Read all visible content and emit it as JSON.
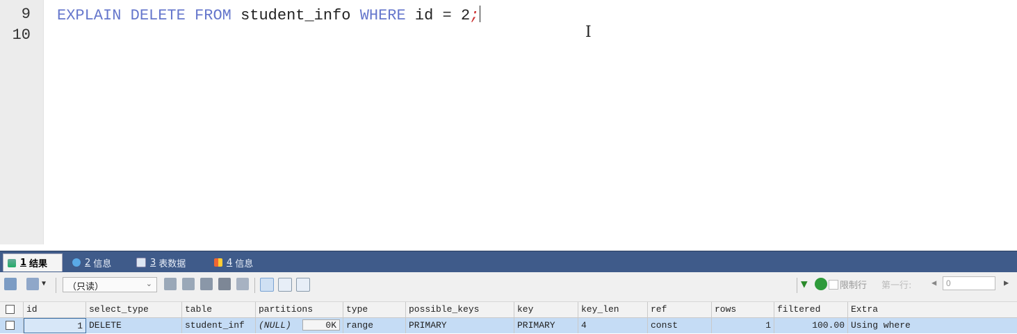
{
  "editor": {
    "lines": [
      {
        "number": "9"
      },
      {
        "number": "10"
      }
    ],
    "code": {
      "explain": "EXPLAIN",
      "delete": "DELETE",
      "from": "FROM",
      "table": "student_info",
      "where": "WHERE",
      "col": "id",
      "eq": "=",
      "val": "2",
      "semi": ";"
    }
  },
  "tabs": [
    {
      "num": "1",
      "label": "结果"
    },
    {
      "num": "2",
      "label": "信息"
    },
    {
      "num": "3",
      "label": "表数据"
    },
    {
      "num": "4",
      "label": "信息"
    }
  ],
  "toolbar": {
    "readonly_label": "（只读）",
    "limit_label": "限制行",
    "first_row_label": "第一行:",
    "row_value": "0"
  },
  "grid": {
    "headers": [
      "id",
      "select_type",
      "table",
      "partitions",
      "type",
      "possible_keys",
      "key",
      "key_len",
      "ref",
      "rows",
      "filtered",
      "Extra"
    ],
    "row": {
      "id": "1",
      "select_type": "DELETE",
      "table": "student_inf",
      "partitions": "(NULL)",
      "partitions_size": "0K",
      "type": "range",
      "possible_keys": "PRIMARY",
      "key": "PRIMARY",
      "key_len": "4",
      "ref": "const",
      "rows": "1",
      "filtered": "100.00",
      "Extra": "Using where"
    }
  },
  "icons": [
    "result-tab-icon",
    "info-tab-icon",
    "tabledata-tab-icon",
    "info2-tab-icon",
    "filter-icon",
    "refresh-icon"
  ],
  "colors": {
    "keyword": "#6677cc",
    "tabbar": "#3f5b8a",
    "selected_row": "#c5dcf5",
    "semicolon": "#cc3333"
  }
}
